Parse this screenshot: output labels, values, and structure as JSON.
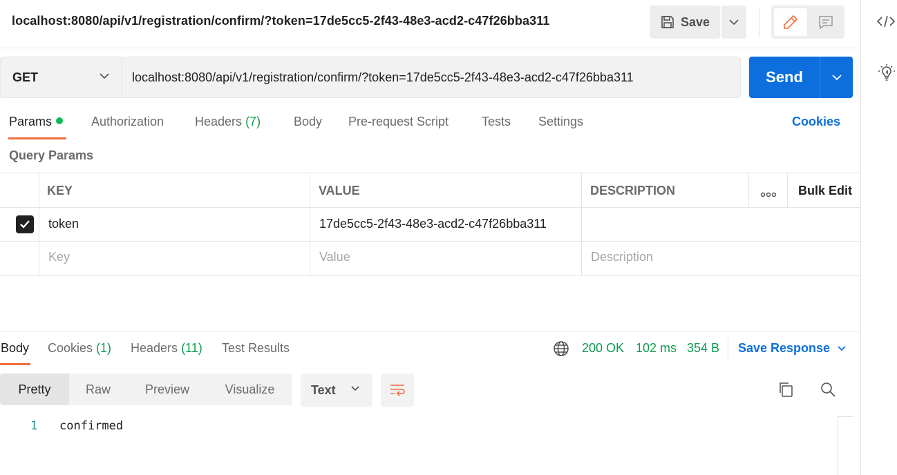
{
  "header": {
    "title": "localhost:8080/api/v1/registration/confirm/?token=17de5cc5-2f43-48e3-acd2-c47f26bba311",
    "save_label": "Save"
  },
  "request": {
    "method": "GET",
    "url": "localhost:8080/api/v1/registration/confirm/?token=17de5cc5-2f43-48e3-acd2-c47f26bba311",
    "send_label": "Send"
  },
  "request_tabs": {
    "params": "Params",
    "authorization": "Authorization",
    "headers": "Headers",
    "headers_count": "(7)",
    "body": "Body",
    "prerequest": "Pre-request Script",
    "tests": "Tests",
    "settings": "Settings",
    "cookies": "Cookies"
  },
  "query_params": {
    "title": "Query Params",
    "columns": {
      "key": "KEY",
      "value": "VALUE",
      "description": "DESCRIPTION",
      "bulk_edit": "Bulk Edit"
    },
    "rows": [
      {
        "checked": true,
        "key": "token",
        "value": "17de5cc5-2f43-48e3-acd2-c47f26bba311",
        "description": ""
      }
    ],
    "placeholders": {
      "key": "Key",
      "value": "Value",
      "description": "Description"
    }
  },
  "response": {
    "tabs": {
      "body": "Body",
      "cookies": "Cookies",
      "cookies_count": "(1)",
      "headers": "Headers",
      "headers_count": "(11)",
      "test_results": "Test Results"
    },
    "status": "200 OK",
    "time": "102 ms",
    "size": "354 B",
    "save_response": "Save Response",
    "views": [
      "Pretty",
      "Raw",
      "Preview",
      "Visualize"
    ],
    "format": "Text",
    "lines": [
      {
        "number": "1",
        "text": "confirmed"
      }
    ]
  },
  "colors": {
    "accent_orange": "#f26b3a",
    "primary_blue": "#0d6fde",
    "success_green": "#0f9c4f"
  },
  "icons": [
    "save-icon",
    "chevron-down-icon",
    "pencil-icon",
    "comment-icon",
    "code-icon",
    "lightbulb-icon",
    "more-horizontal-icon",
    "checkmark-icon",
    "globe-icon",
    "wrap-lines-icon",
    "copy-icon",
    "search-icon"
  ]
}
